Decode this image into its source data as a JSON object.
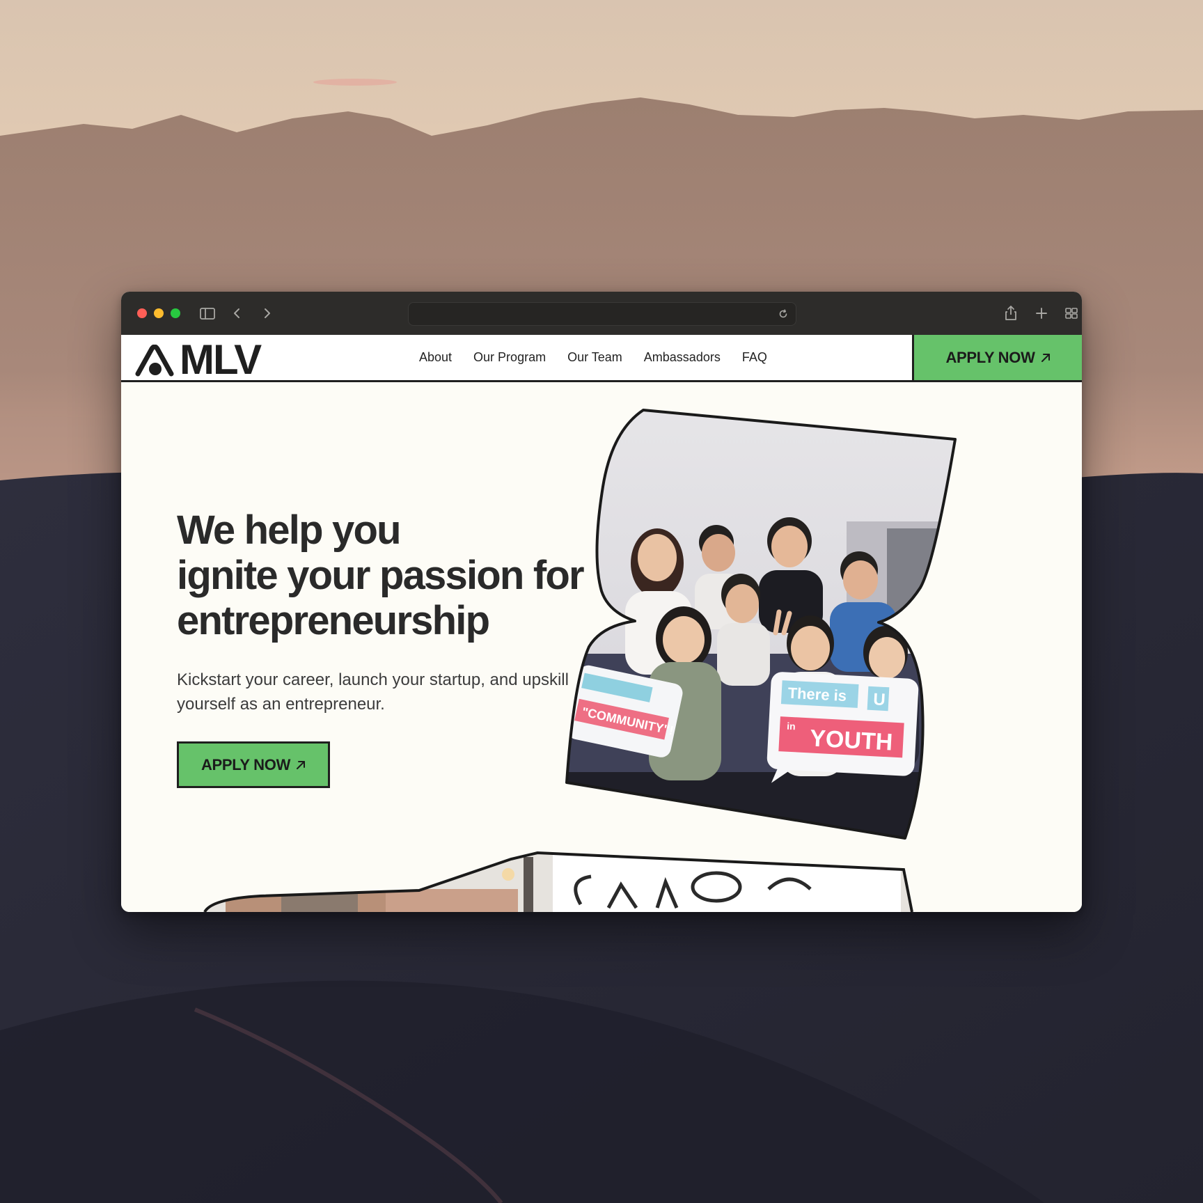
{
  "desktop": {
    "wallpaper": "desert-dunes-at-dusk"
  },
  "browser": {
    "traffic_lights": {
      "close": "#ff5f57",
      "minimize": "#febc2e",
      "zoom": "#28c840"
    },
    "icons": [
      "sidebar-icon",
      "back-icon",
      "forward-icon",
      "reload-icon",
      "share-icon",
      "new-tab-icon",
      "tab-overview-icon"
    ],
    "address": ""
  },
  "site": {
    "logo_text": "MLV",
    "nav": [
      "About",
      "Our Program",
      "Our Team",
      "Ambassadors",
      "FAQ"
    ],
    "apply_label": "APPLY NOW",
    "accent_color": "#66c26a"
  },
  "hero": {
    "headline_line1": "We help you",
    "headline_line2": "ignite your passion for",
    "headline_line3": "entrepreneurship",
    "subtext": "Kickstart your career, launch your startup, and upskill yourself as an entrepreneur.",
    "cta_label": "APPLY NOW",
    "photo_signs": [
      "\"COMMUNITY\"!",
      "There is",
      "U",
      "in",
      "YOUTH"
    ]
  }
}
